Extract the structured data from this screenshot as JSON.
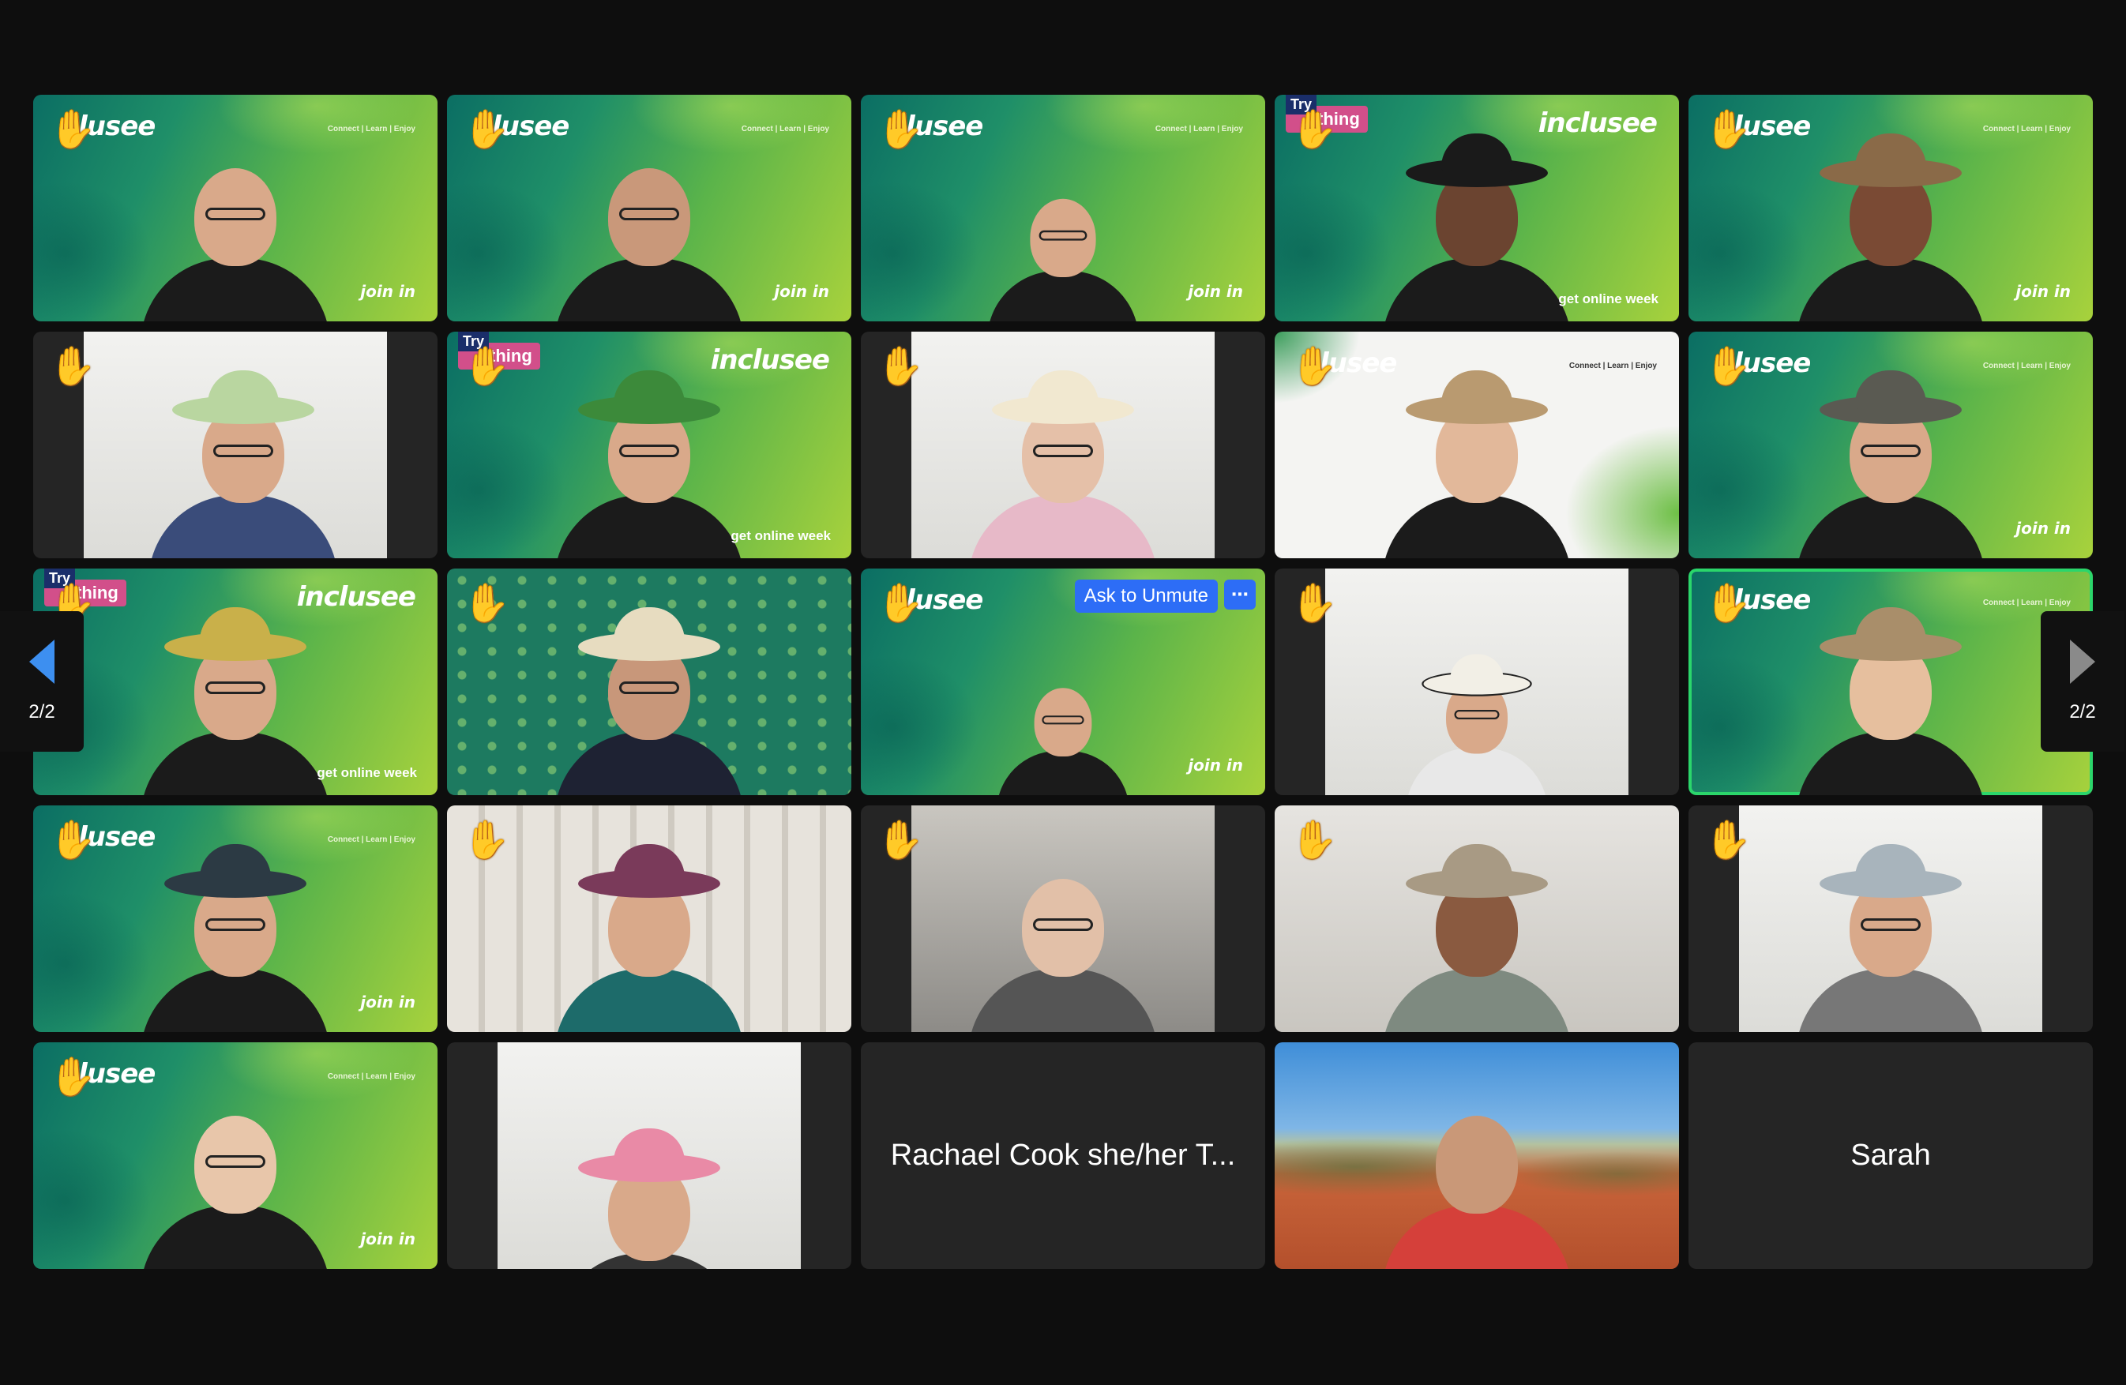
{
  "branding": {
    "logo": "inclusee",
    "logo_partial": "clusee",
    "tagline": "Connect | Learn | Enjoy",
    "join_in": "join in",
    "get_online": "get online week",
    "try_thing_top": "Try",
    "try_thing_bottom": "thing"
  },
  "participants": {
    "rachael": "Rachael Cook she/her T...",
    "sarah": "Sarah"
  },
  "controls": {
    "ask_to_unmute": "Ask to Unmute",
    "more": "⋯"
  },
  "pagination": {
    "left_label": "2/2",
    "right_label": "2/2"
  },
  "icons": {
    "raised_hand": "✋",
    "pager_prev": "triangle-left",
    "pager_next": "triangle-right"
  },
  "colors": {
    "speaking_border": "#2bd66b",
    "button_blue": "#2d6df6",
    "try_badge": "#d24f8a"
  }
}
